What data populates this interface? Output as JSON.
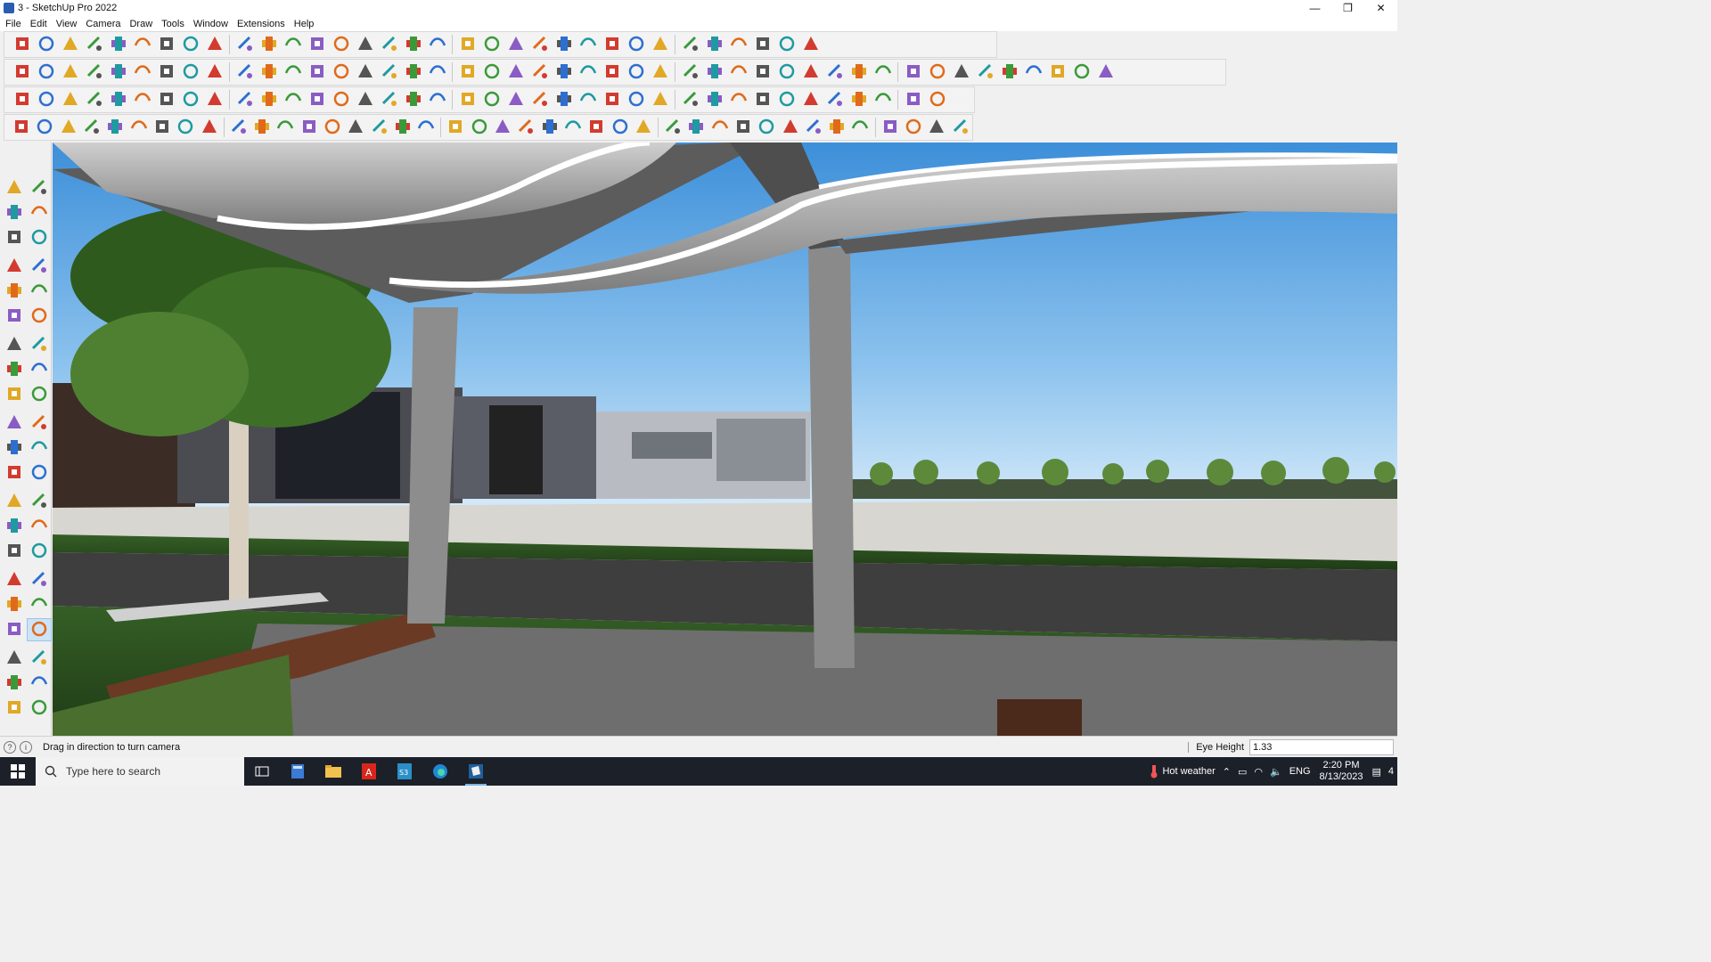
{
  "window": {
    "title": "3 - SketchUp Pro 2022",
    "minimize": "—",
    "maximize": "❐",
    "close": "✕"
  },
  "menu": [
    "File",
    "Edit",
    "View",
    "Camera",
    "Draw",
    "Tools",
    "Window",
    "Extensions",
    "Help"
  ],
  "status": {
    "message": "Drag in direction to turn camera",
    "measure_label": "Eye Height",
    "measure_value": "1.33"
  },
  "taskbar": {
    "search_placeholder": "Type here to search",
    "weather": "Hot weather",
    "language": "ENG",
    "time": "2:20 PM",
    "date": "8/13/2023",
    "notifications": "4"
  },
  "icons": {
    "toolbar_row1": [
      "zoom-icon",
      "select-icon",
      "eraser-icon",
      "pencil-icon",
      "lasso-icon",
      "paint-icon",
      "pushpull-icon",
      "followme-icon",
      "move-icon",
      "rotate-icon",
      "scale-icon",
      "tape-icon",
      "text-icon",
      "paint-bucket-icon",
      "orbit-icon",
      "pan-icon",
      "zoom-window-icon",
      "zoom-extents-icon",
      "components-icon",
      "styles-icon",
      "layers-icon",
      "shadows-icon",
      "account-icon",
      "warehouse-icon",
      "extension-icon",
      "sandbox-icon",
      "export-icon",
      "import-icon",
      "solid-icon",
      "section-icon",
      "undo-icon",
      "redo-icon",
      "hand-icon"
    ],
    "toolbar_row2": [
      "iso-view-icon",
      "top-view-icon",
      "front-view-icon",
      "push-icon",
      "arrow-down-icon",
      "arrow-red-icon",
      "arrow-green-icon",
      "arrow-orange-icon",
      "arrow-up-icon",
      "arrow-x-icon",
      "arrow-pink-icon",
      "curve-icon",
      "face-icon",
      "mirror-icon",
      "slash-icon",
      "cube-green-icon",
      "move-green-icon",
      "house-1-icon",
      "house-2-icon",
      "house-3-icon",
      "house-4-icon",
      "house-5-icon",
      "house-6-icon",
      "text-tool-icon",
      "leaf-icon",
      "pen-icon",
      "shape-1-icon",
      "shape-2-icon",
      "shape-3-icon",
      "shape-4-icon",
      "shape-5-icon",
      "shape-6-icon",
      "shape-7-icon",
      "shape-8-icon",
      "shape-9-icon",
      "shape-10-icon",
      "line-red-icon",
      "eraser-pink-icon",
      "texture-1-icon",
      "texture-2-icon",
      "texture-3-icon",
      "texture-4-icon",
      "texture-5-icon",
      "texture-6-icon",
      "texture-7-icon"
    ],
    "toolbar_row3": [
      "blue-plane-icon",
      "blue-diamond-icon",
      "yellow-plane-icon",
      "green-plane-icon",
      "red-plane-icon",
      "white-plane-icon",
      "bend-icon",
      "red-square-icon",
      "grid-icon",
      "frame-icon",
      "box-icon",
      "chain-icon",
      "hook-icon",
      "dots-icon",
      "plus-icon",
      "cross-icon",
      "cone-icon",
      "tree-icon",
      "triangle-icon",
      "loop-icon",
      "knot-icon",
      "spiral-icon",
      "snap-icon",
      "bucket-icon",
      "undo-red-icon",
      "stack-icon",
      "gear-a-icon",
      "gear-b-icon",
      "gear-c-icon",
      "gift-icon",
      "pattern-icon",
      "panel-icon",
      "tile-icon",
      "window-icon",
      "hash-icon",
      "scatter-icon",
      "arc-icon",
      "multi-icon"
    ],
    "toolbar_row4": [
      "line-tool-icon",
      "bezier-icon",
      "car-icon",
      "cut-icon",
      "wheel-icon",
      "fold-icon",
      "sweep-icon",
      "box3d-icon",
      "cage-icon",
      "flip-icon",
      "stair-a-icon",
      "stair-b-icon",
      "line-x-icon",
      "curl-icon",
      "table-icon",
      "ruler-icon",
      "column-a-icon",
      "column-b-icon",
      "fan-icon",
      "leaf-b-icon",
      "bird-icon",
      "book-icon",
      "flat-icon",
      "arrows-a-icon",
      "arrows-b-icon",
      "arrows-c-icon",
      "car-b-icon",
      "stripes-a-icon",
      "stripes-b-icon",
      "stripes-c-icon",
      "stripes-d-icon",
      "stripes-e-icon",
      "stripes-f-icon",
      "stripes-g-icon",
      "stripes-h-icon",
      "stripes-i-icon",
      "stripes-j-icon",
      "stripes-k-icon",
      "stripes-l-icon",
      "shell-icon"
    ],
    "left_tools": [
      "select-icon",
      "component-icon",
      "paint-bucket-icon",
      "eraser-icon",
      "tag-icon",
      "line-icon",
      "line-tool-icon",
      "freehand-icon",
      "rectangle-icon",
      "rotated-rect-icon",
      "circle-icon",
      "polygon-icon",
      "arc-icon",
      "pie-icon",
      "2pt-arc-icon",
      "3pt-arc-icon",
      "move-icon",
      "pushpull-icon",
      "rotate-icon",
      "followme-icon",
      "scale-icon",
      "offset-icon",
      "tape-icon",
      "dimension-icon",
      "protractor-icon",
      "text-icon",
      "axes-icon",
      "3dtext-icon",
      "orbit-icon",
      "pan-icon",
      "zoom-icon",
      "zoom-window-icon",
      "zoom-extents-icon",
      "previous-icon",
      "position-camera-icon",
      "look-around-icon",
      "walk-icon",
      "section-icon",
      "warehouse-icon",
      "extension-warehouse-icon",
      "layout-icon",
      "styles-icon"
    ]
  }
}
